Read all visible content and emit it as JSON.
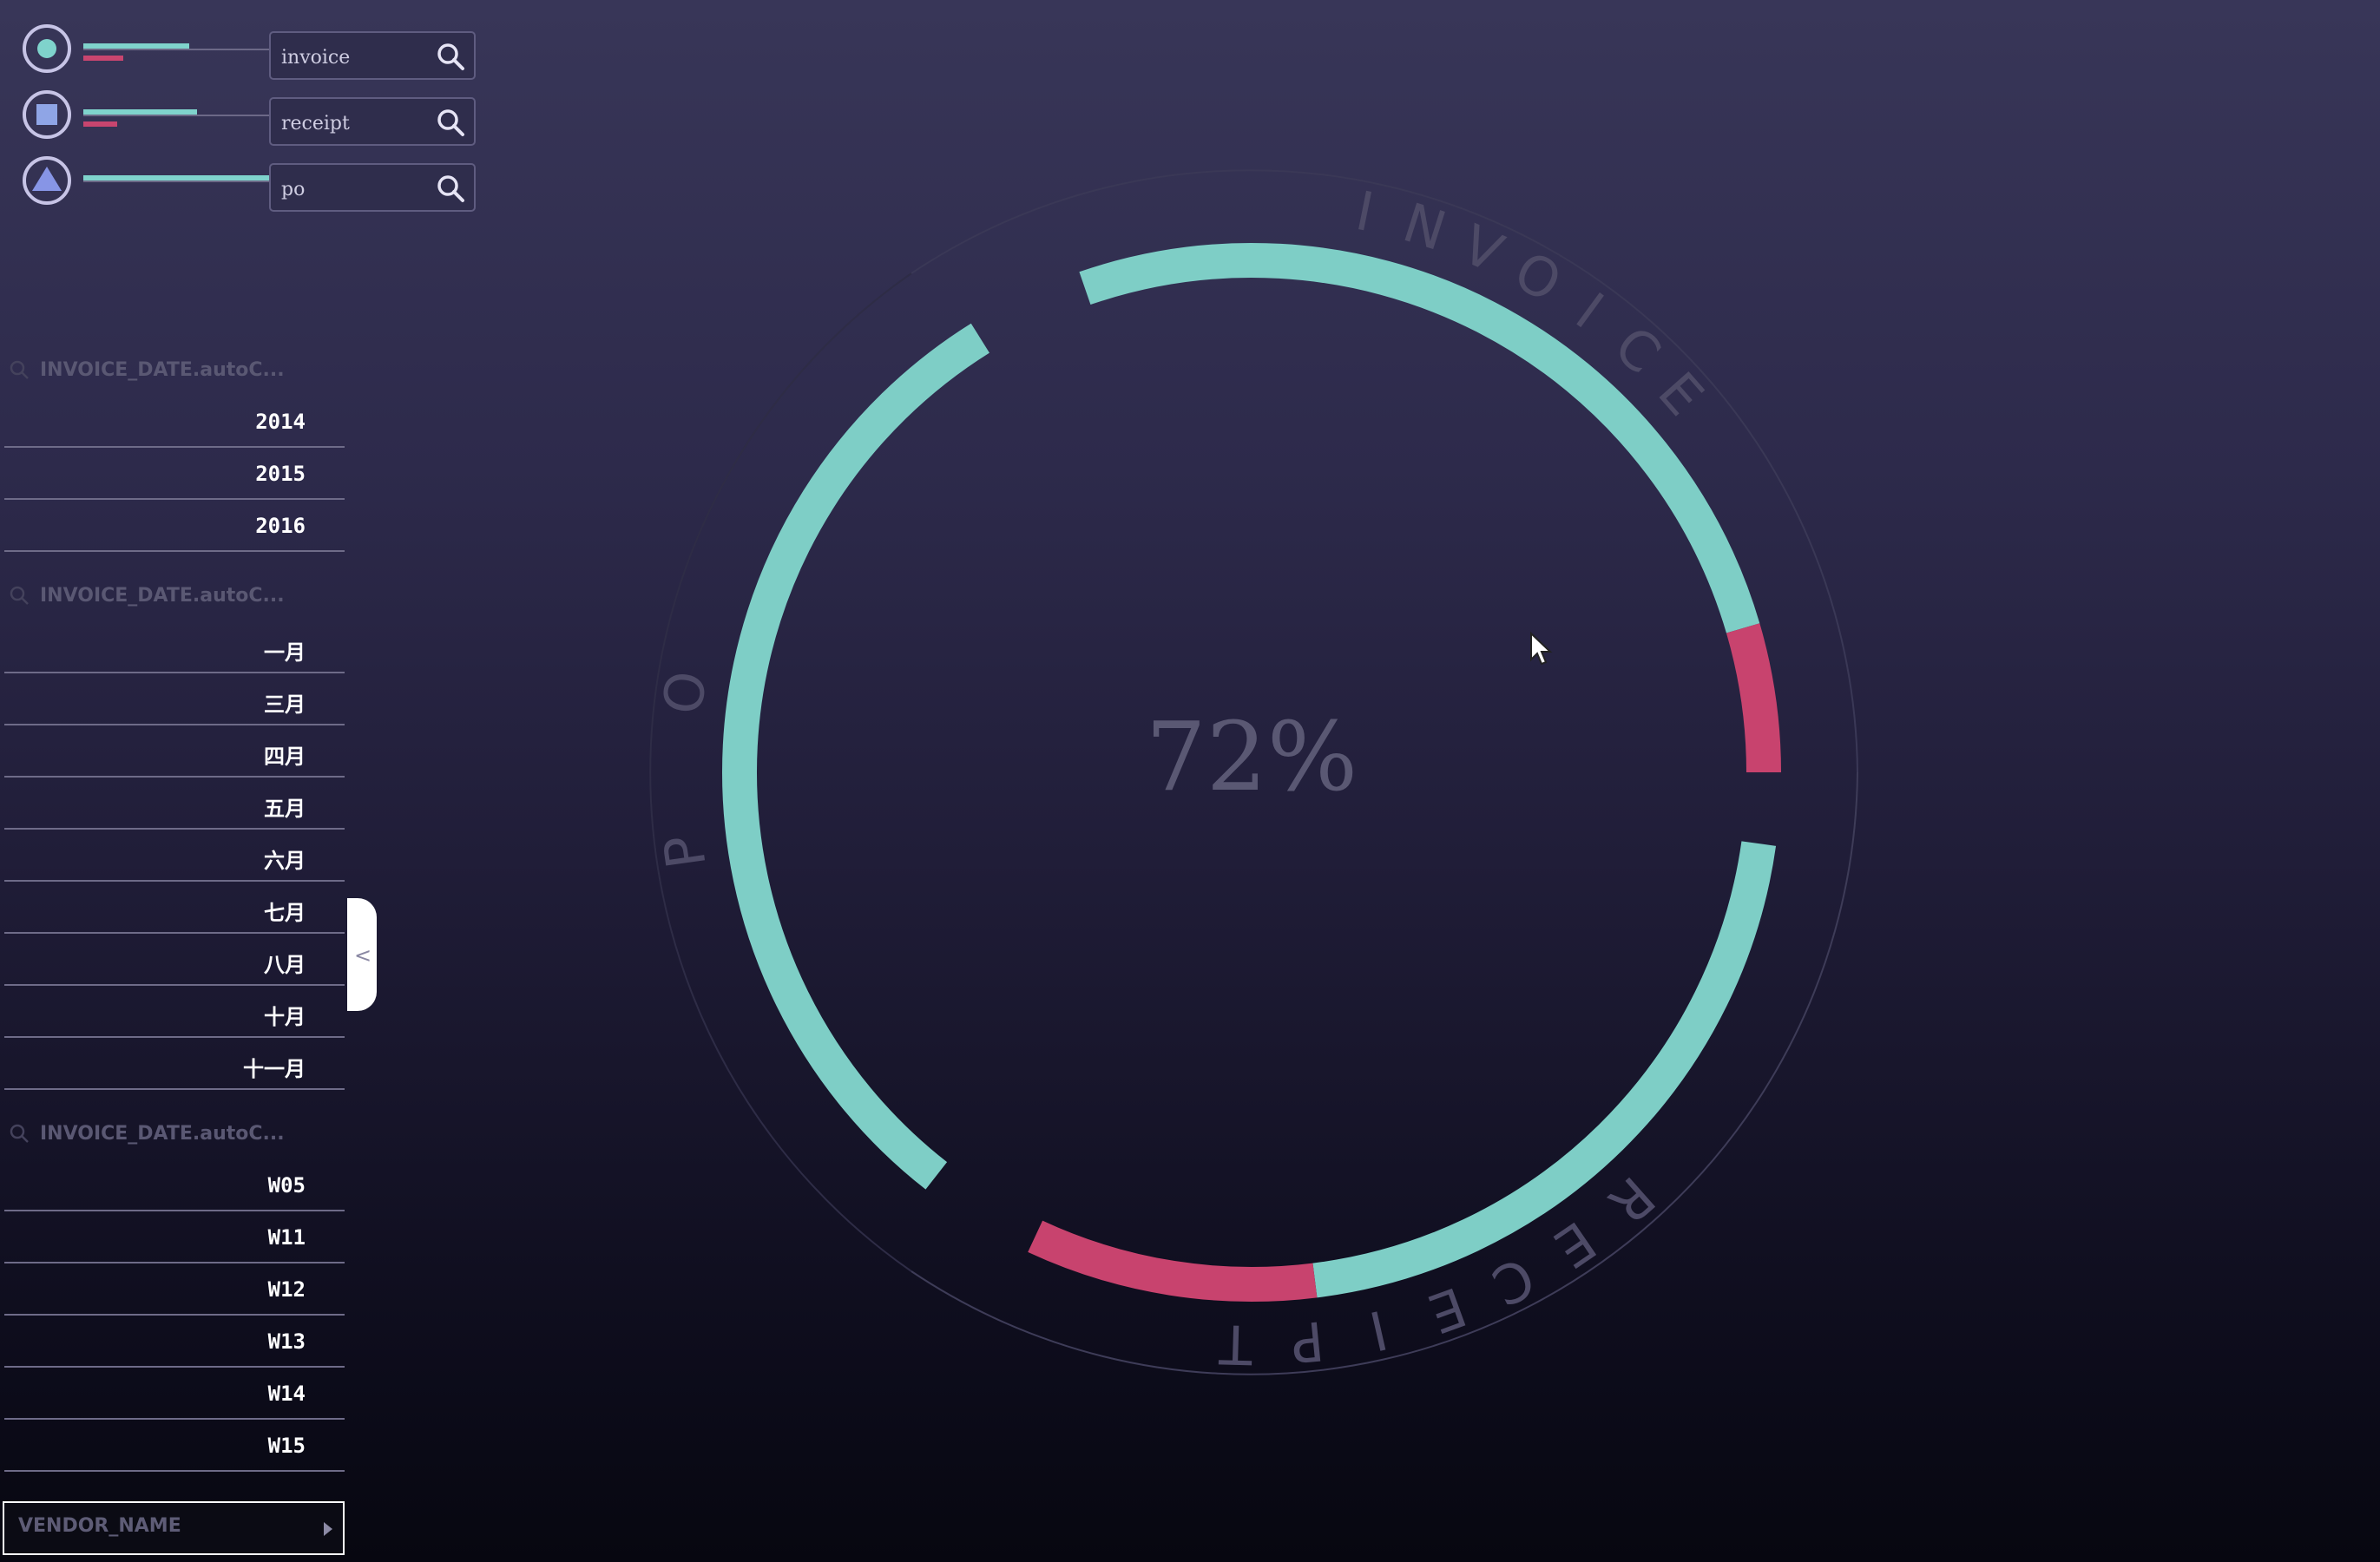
{
  "filters": [
    {
      "shape": "circle",
      "query": "invoice",
      "teal_level": 0.53,
      "pink_level": 0.2
    },
    {
      "shape": "square",
      "query": "receipt",
      "teal_level": 0.57,
      "pink_level": 0.17
    },
    {
      "shape": "triangle",
      "query": "po",
      "teal_level": 1.0,
      "pink_level": 0.0
    }
  ],
  "lists": {
    "year": {
      "header": "INVOICE_DATE.autoC...",
      "items": [
        "2014",
        "2015",
        "2016"
      ]
    },
    "month": {
      "header": "INVOICE_DATE.autoC...",
      "items": [
        "一月",
        "三月",
        "四月",
        "五月",
        "六月",
        "七月",
        "八月",
        "十月",
        "十一月"
      ]
    },
    "week": {
      "header": "INVOICE_DATE.autoC...",
      "items": [
        "W05",
        "W11",
        "W12",
        "W13",
        "W14",
        "W15"
      ]
    }
  },
  "vendor_field": "VENDOR_NAME",
  "collapse_glyph": "<",
  "chart": {
    "center_value": "72%",
    "labels": {
      "invoice": "INVOICE",
      "receipt": "RECEIPT",
      "po": "PO"
    },
    "colors": {
      "match": "#7ecec6",
      "mismatch": "#c8436e",
      "label": "#4d4a66",
      "center": "#5a5873"
    },
    "segments": [
      {
        "name": "invoice",
        "match_share": 0.85,
        "mismatch_share": 0.15
      },
      {
        "name": "receipt",
        "match_share": 0.7,
        "mismatch_share": 0.3
      },
      {
        "name": "po",
        "match_share": 1.0,
        "mismatch_share": 0.0
      }
    ]
  }
}
